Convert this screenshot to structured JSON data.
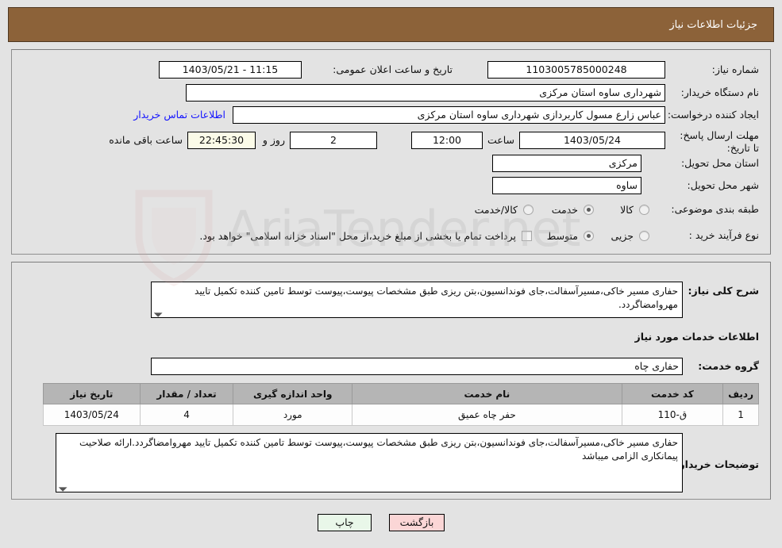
{
  "header": {
    "title": "جزئیات اطلاعات نیاز"
  },
  "form": {
    "need_number_label": "شماره نیاز:",
    "need_number_value": "1103005785000248",
    "public_announce_label": "تاریخ و ساعت اعلان عمومی:",
    "public_announce_value": "11:15 - 1403/05/21",
    "buyer_org_label": "نام دستگاه خریدار:",
    "buyer_org_value": "شهرداری ساوه استان مرکزی",
    "requester_label": "ایجاد کننده درخواست:",
    "requester_value": "عباس زارع مسول کاربردازی شهرداری ساوه استان مرکزی",
    "buyer_contact_link": "اطلاعات تماس خریدار",
    "deadline_label": "مهلت ارسال پاسخ: تا تاریخ:",
    "deadline_date": "1403/05/24",
    "hour_word": "ساعت",
    "deadline_time": "12:00",
    "remaining_days": "2",
    "days_and_word": "روز و",
    "remaining_time": "22:45:30",
    "remaining_suffix": "ساعت باقی مانده",
    "province_label": "استان محل تحویل:",
    "province_value": "مرکزی",
    "city_label": "شهر محل تحویل:",
    "city_value": "ساوه",
    "category_label": "طبقه بندی موضوعی:",
    "category_options": [
      {
        "label": "کالا",
        "selected": false
      },
      {
        "label": "خدمت",
        "selected": true
      },
      {
        "label": "کالا/خدمت",
        "selected": false
      }
    ],
    "process_label": "نوع فرآیند خرید :",
    "process_options": [
      {
        "label": "جزیی",
        "selected": false
      },
      {
        "label": "متوسط",
        "selected": true
      }
    ],
    "treasury_checkbox_label": "پرداخت تمام یا بخشی از مبلغ خرید،از محل \"اسناد خزانه اسلامی\" خواهد بود.",
    "treasury_checked": false
  },
  "details": {
    "general_desc_label": "شرح کلی نیاز:",
    "general_desc_value": "حفاری مسیر خاکی،مسیرآسفالت،جای فوندانسیون،بتن ریزی طبق مشخصات پیوست،پیوست توسط تامین کننده تکمیل تایید مهروامضاگردد.",
    "services_section_title": "اطلاعات خدمات مورد نیاز",
    "service_group_label": "گروه خدمت:",
    "service_group_value": "حفاری چاه",
    "buyer_notes_label": "توضیحات خریدار:",
    "buyer_notes_value": "حفاری مسیر خاکی،مسیرآسفالت،جای فوندانسیون،بتن ریزی طبق مشخصات پیوست،پیوست توسط تامین کننده تکمیل تایید مهروامضاگردد.ارائه صلاحیت پیمانکاری الزامی میباشد"
  },
  "table": {
    "headers": [
      "ردیف",
      "کد خدمت",
      "نام خدمت",
      "واحد اندازه گیری",
      "تعداد / مقدار",
      "تاریخ نیاز"
    ],
    "rows": [
      {
        "row_no": "1",
        "service_code": "ق-110",
        "service_name": "حفر چاه عمیق",
        "unit": "مورد",
        "quantity": "4",
        "need_date": "1403/05/24"
      }
    ]
  },
  "footer": {
    "print_label": "چاپ",
    "back_label": "بازگشت"
  },
  "colors": {
    "header_bg": "#8c6239",
    "page_bg": "#e3e3e3",
    "link": "#1414ff",
    "table_header_bg": "#b5b5b5",
    "beige_field": "#fbfbe8",
    "print_btn": "#e9f7e9",
    "back_btn": "#fbd6d6"
  },
  "watermark": {
    "text": "AriaTender.net"
  }
}
